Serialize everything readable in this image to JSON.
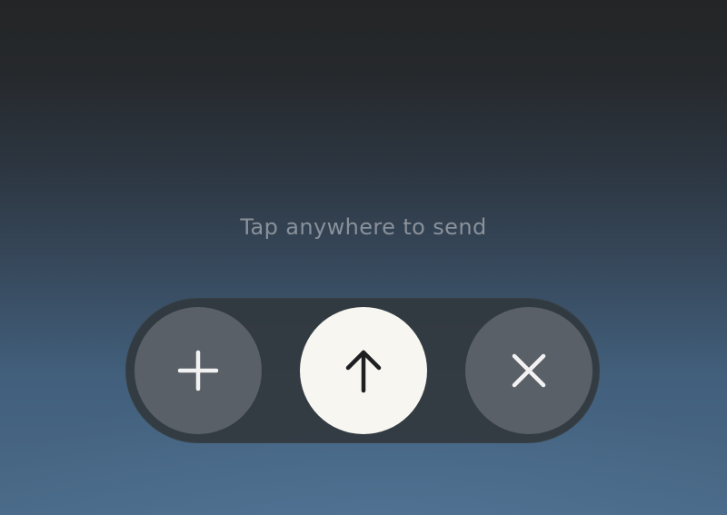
{
  "hint": {
    "text": "Tap anywhere to send"
  },
  "actions": [
    {
      "name": "add",
      "icon": "plus-icon"
    },
    {
      "name": "send",
      "icon": "arrow-up-icon"
    },
    {
      "name": "close",
      "icon": "close-icon"
    }
  ],
  "colors": {
    "background_top": "#232526",
    "background_bottom": "#4a6a88",
    "hint_text": "#8a919a",
    "pill": "#32383e",
    "secondary_button": "#5a6068",
    "primary_button": "#f7f6f1",
    "icon_light": "#f2f2f2",
    "icon_dark": "#1e1f21"
  }
}
